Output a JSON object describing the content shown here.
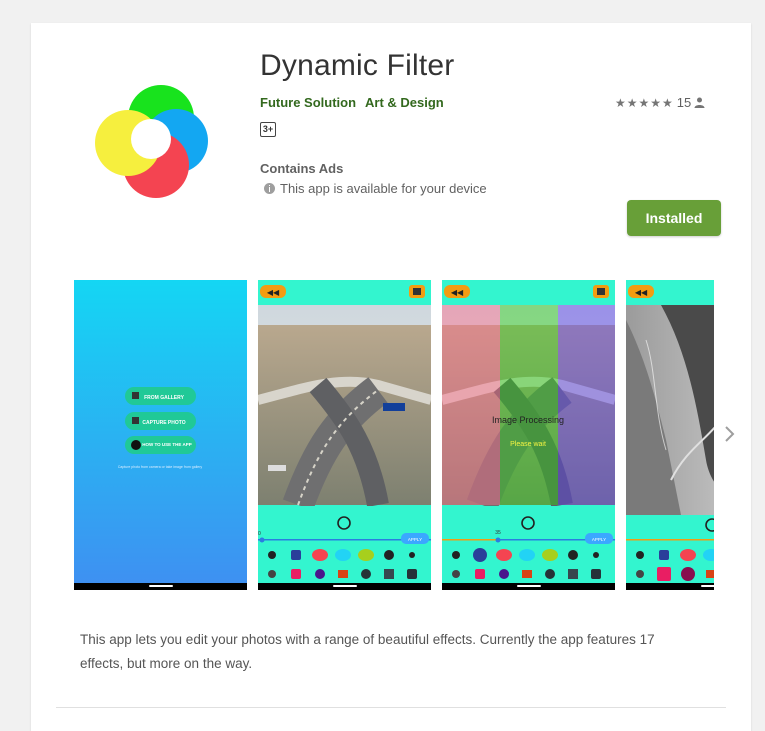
{
  "app": {
    "title": "Dynamic Filter",
    "developer": "Future Solution",
    "category": "Art & Design",
    "rating_stars": "★★★★★",
    "rating_count": "15",
    "age_rating": "3+",
    "contains_ads": "Contains Ads",
    "availability": "This app is available for your device",
    "install_label": "Installed",
    "description": "This app lets you edit your photos with a range of beautiful effects. Currently the app features 17 effects, but more on the way."
  },
  "screenshots": {
    "shot1": {
      "buttons": [
        "FROM GALLERY",
        "CAPTURE PHOTO",
        "HOW TO USE THE APP"
      ],
      "caption": "Capture photo from camera or take image from gallery"
    },
    "shot2": {
      "slider_value": "0",
      "apply_label": "APPLY"
    },
    "shot3": {
      "processing_text": "Image Processing",
      "wait_text": "Please wait",
      "slider_value": "35",
      "apply_label": "APPLY"
    }
  },
  "colors": {
    "accent": "#689f38",
    "link": "#33691e",
    "teal": "#33f5cf",
    "orange": "#f39c12",
    "blue_gradient_top": "#14d6f3",
    "blue_gradient_bottom": "#3f8ff2"
  },
  "icons": {
    "next": "chevron-right-icon",
    "user": "person-icon",
    "info": "info-icon"
  }
}
